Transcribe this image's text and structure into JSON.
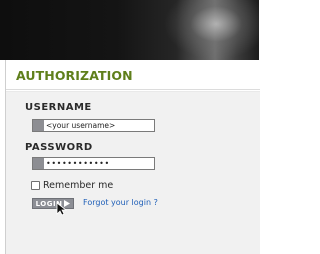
{
  "panel": {
    "title": "AUTHORIZATION"
  },
  "form": {
    "username_label": "USERNAME",
    "username_value": "<your username>",
    "password_label": "PASSWORD",
    "password_value": "••••••••••••",
    "remember_label": "Remember me",
    "remember_checked": false,
    "login_label": "LOGIN",
    "forgot_label": "Forgot your login ?"
  },
  "colors": {
    "header_title": "#5f7f1b",
    "link": "#2060b8",
    "button": "#8c8e95",
    "field_accent": "#8d8e93"
  },
  "icons": {
    "login_arrow": "triangle-right-icon",
    "cursor": "mouse-pointer-icon"
  }
}
